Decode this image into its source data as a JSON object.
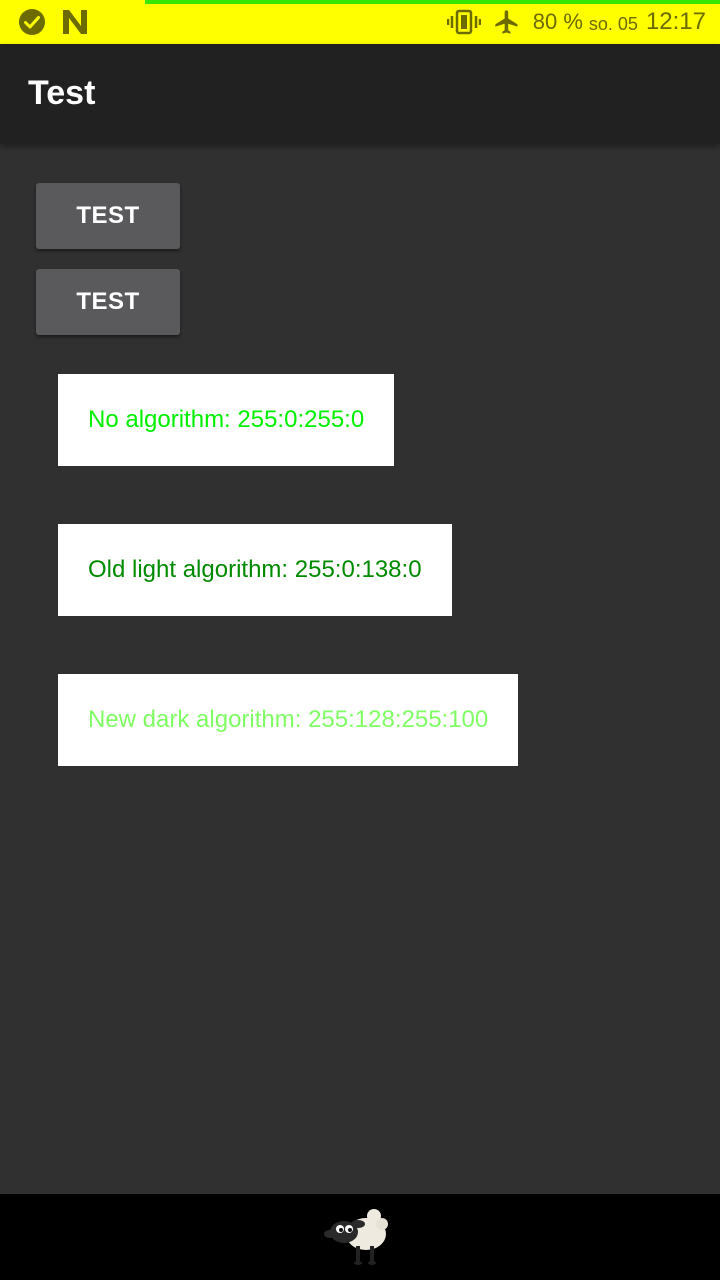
{
  "status_bar": {
    "battery": "80 %",
    "date": "so. 05",
    "time": "12:17",
    "icons": [
      "check-circle-icon",
      "n-logo-icon",
      "vibrate-icon",
      "airplane-icon"
    ]
  },
  "app_bar": {
    "title": "Test"
  },
  "buttons": [
    {
      "label": "TEST"
    },
    {
      "label": "TEST"
    }
  ],
  "cards": [
    {
      "text": "No algorithm: 255:0:255:0",
      "color": "#00f000"
    },
    {
      "text": "Old light algorithm: 255:0:138:0",
      "color": "#008a00"
    },
    {
      "text": "New dark algorithm: 255:128:255:100",
      "color": "#80ff64"
    }
  ],
  "nav_bar": {
    "icon": "sheep-icon"
  }
}
